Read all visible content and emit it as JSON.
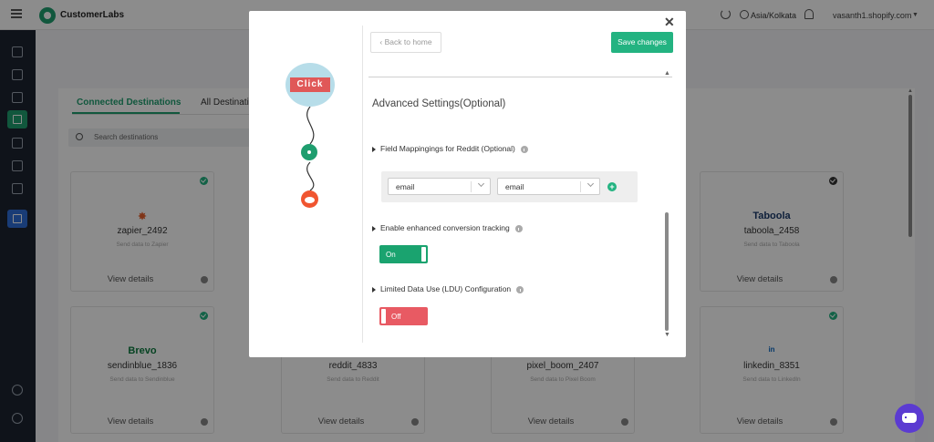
{
  "app": {
    "brand": "CustomerLabs"
  },
  "topbar": {
    "timezone": "Asia/Kolkata",
    "store": "vasanth1.shopify.com"
  },
  "tabs": {
    "connected": "Connected Destinations",
    "all": "All Destinations"
  },
  "search": {
    "placeholder": "Search destinations"
  },
  "cards": [
    {
      "logo": "✸",
      "logo_color": "#e8612c",
      "name": "zapier_2492",
      "sub": "Send data to Zapier",
      "link": "View details",
      "status": "connected"
    },
    {
      "logo": "Taboola",
      "logo_color": "#1a3a6b",
      "name": "taboola_2458",
      "sub": "Send data to Taboola",
      "link": "View details",
      "status": "not-connected"
    },
    {
      "logo": "Brevo",
      "logo_color": "#0b7a3e",
      "name": "sendinblue_1836",
      "sub": "Send data to Sendinblue",
      "link": "View details",
      "status": "connected"
    },
    {
      "logo": "",
      "logo_color": "#f05530",
      "name": "reddit_4833",
      "sub": "Send data to Reddit",
      "link": "View details",
      "status": "none"
    },
    {
      "logo": "",
      "logo_color": "#333333",
      "name": "pixel_boom_2407",
      "sub": "Send data to Pixel Boom",
      "link": "View details",
      "status": "none"
    },
    {
      "logo": "in",
      "logo_color": "#0a66c2",
      "name": "linkedin_8351",
      "sub": "Send data to LinkedIn",
      "link": "View details",
      "status": "connected"
    }
  ],
  "modal": {
    "click_label": "Click",
    "back_button": "Back to home",
    "save_button": "Save changes",
    "title": "Advanced Settings(Optional)",
    "field_mappings_label": "Field Mappingings for Reddit (Optional)",
    "mapping": {
      "left_value": "email",
      "right_value": "email"
    },
    "enhanced_label": "Enable enhanced conversion tracking",
    "enhanced_toggle": "On",
    "ldu_label": "Limited Data Use (LDU) Configuration",
    "ldu_toggle": "Off"
  },
  "colors": {
    "brand_green": "#1f9e6f",
    "save_green": "#23b381",
    "on_green": "#1aa36f",
    "off_red": "#e85a63",
    "check_green": "#23b381",
    "check_dark": "#333333"
  }
}
